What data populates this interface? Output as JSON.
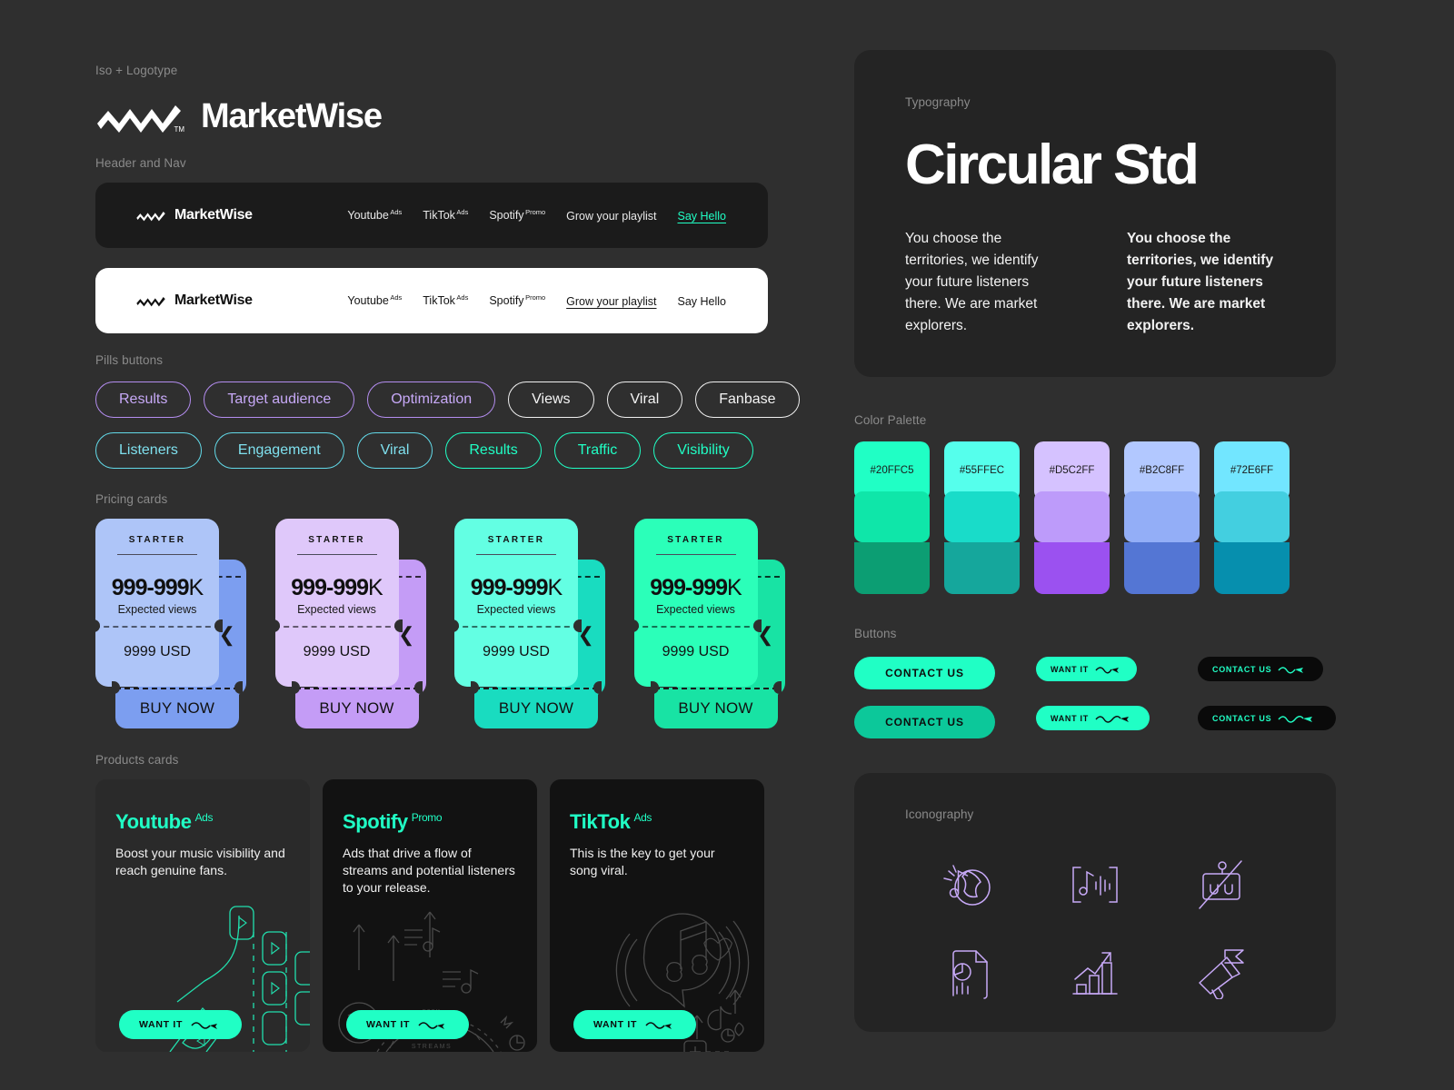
{
  "sections": {
    "logotype": "Iso + Logotype",
    "header_nav": "Header and Nav",
    "pills": "Pills buttons",
    "pricing": "Pricing cards",
    "products": "Products cards",
    "typography": "Typography",
    "color_palette": "Color Palette",
    "buttons": "Buttons",
    "iconography": "Iconography"
  },
  "brand": {
    "name": "MarketWise",
    "tm": "TM"
  },
  "navbars": [
    {
      "theme": "dark",
      "brand": "MarketWise",
      "links": [
        {
          "label": "Youtube",
          "sup": "Ads",
          "style": "plain"
        },
        {
          "label": "TikTok",
          "sup": "Ads",
          "style": "plain"
        },
        {
          "label": "Spotify",
          "sup": "Promo",
          "style": "plain"
        },
        {
          "label": "Grow your playlist",
          "sup": "",
          "style": "plain"
        },
        {
          "label": "Say Hello",
          "sup": "",
          "style": "accent"
        }
      ]
    },
    {
      "theme": "light",
      "brand": "MarketWise",
      "links": [
        {
          "label": "Youtube",
          "sup": "Ads",
          "style": "plain"
        },
        {
          "label": "TikTok",
          "sup": "Ads",
          "style": "plain"
        },
        {
          "label": "Spotify",
          "sup": "Promo",
          "style": "plain"
        },
        {
          "label": "Grow your playlist",
          "sup": "",
          "style": "underlined"
        },
        {
          "label": "Say Hello",
          "sup": "",
          "style": "plain"
        }
      ]
    }
  ],
  "pills": {
    "row1": [
      {
        "label": "Results",
        "color": "purple"
      },
      {
        "label": "Target audience",
        "color": "purple"
      },
      {
        "label": "Optimization",
        "color": "purple"
      },
      {
        "label": "Views",
        "color": "white"
      },
      {
        "label": "Viral",
        "color": "white"
      },
      {
        "label": "Fanbase",
        "color": "white"
      }
    ],
    "row2": [
      {
        "label": "Listeners",
        "color": "cyan"
      },
      {
        "label": "Engagement",
        "color": "cyan"
      },
      {
        "label": "Viral",
        "color": "cyan"
      },
      {
        "label": "Results",
        "color": "green"
      },
      {
        "label": "Traffic",
        "color": "green"
      },
      {
        "label": "Visibility",
        "color": "green"
      }
    ]
  },
  "pricing_cards": [
    {
      "plan": "STARTER",
      "price_bold": "999-999",
      "price_unit": "K",
      "sub": "Expected views",
      "usd": "9999 USD",
      "buy": "BUY NOW",
      "front": "#AEC5F8",
      "back": "#7C9EF0",
      "foot": "#7C9EF0"
    },
    {
      "plan": "STARTER",
      "price_bold": "999-999",
      "price_unit": "K",
      "sub": "Expected views",
      "usd": "9999 USD",
      "buy": "BUY NOW",
      "front": "#DFC8FA",
      "back": "#C49CF6",
      "foot": "#C49CF6"
    },
    {
      "plan": "STARTER",
      "price_bold": "999-999",
      "price_unit": "K",
      "sub": "Expected views",
      "usd": "9999 USD",
      "buy": "BUY NOW",
      "front": "#63FFE3",
      "back": "#19DCC0",
      "foot": "#19DCC0"
    },
    {
      "plan": "STARTER",
      "price_bold": "999-999",
      "price_unit": "K",
      "sub": "Expected views",
      "usd": "9999 USD",
      "buy": "BUY NOW",
      "front": "#2BFFB9",
      "back": "#18E3A4",
      "foot": "#18E3A4"
    }
  ],
  "product_cards": [
    {
      "title": "Youtube",
      "sup": "Ads",
      "desc": "Boost your music visibility and reach genuine fans.",
      "button": "WANT IT",
      "theme": "dark",
      "art": "youtube"
    },
    {
      "title": "Spotify",
      "sup": "Promo",
      "desc": "Ads that drive a flow of streams and potential listeners to your release.",
      "button": "WANT IT",
      "theme": "black",
      "art": "spotify"
    },
    {
      "title": "TikTok",
      "sup": "Ads",
      "desc": "This is the key to get your song viral.",
      "button": "WANT IT",
      "theme": "black",
      "art": "tiktok"
    }
  ],
  "typography": {
    "font_name": "Circular Std",
    "sample_regular": "You choose the territories, we identify your future listeners there. We are market explorers.",
    "sample_bold": "You choose the territories, we identify your future listeners there. We are market explorers."
  },
  "palette": [
    {
      "code": "#20FFC5",
      "top": "#20FFC5",
      "mid": "#0FE6A9",
      "bottom": "#0C9E73"
    },
    {
      "code": "#55FFEC",
      "top": "#55FFEC",
      "mid": "#19DCC9",
      "bottom": "#15A79C"
    },
    {
      "code": "#D5C2FF",
      "top": "#D5C2FF",
      "mid": "#BD9BFA",
      "bottom": "#9B51F0"
    },
    {
      "code": "#B2C8FF",
      "top": "#B2C8FF",
      "mid": "#93AEF7",
      "bottom": "#5476D4"
    },
    {
      "code": "#72E6FF",
      "top": "#72E6FF",
      "mid": "#43CFE0",
      "bottom": "#068FAE"
    }
  ],
  "buttons": [
    {
      "label": "CONTACT US",
      "variant": "solid-large",
      "arrow": false
    },
    {
      "label": "WANT IT",
      "variant": "solid-medium",
      "arrow": true
    },
    {
      "label": "CONTACT US",
      "variant": "dark",
      "arrow": true
    },
    {
      "label": "CONTACT US",
      "variant": "solid-large-deep",
      "arrow": false
    },
    {
      "label": "WANT IT",
      "variant": "solid-medium-long",
      "arrow": true
    },
    {
      "label": "CONTACT US",
      "variant": "dark-long",
      "arrow": true
    }
  ],
  "icons": [
    "globe-music-icon",
    "audio-waveform-icon",
    "no-ads-icon",
    "document-analytics-icon",
    "growth-chart-icon",
    "megaphone-flag-icon"
  ],
  "colors": {
    "background": "#2f2f2f",
    "panel": "#242424",
    "accent": "#20FFC5",
    "label": "#8a8a8a"
  }
}
